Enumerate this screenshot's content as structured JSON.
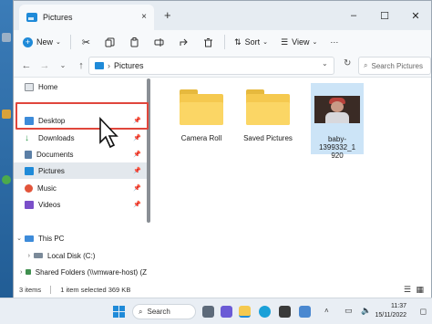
{
  "window": {
    "tab_title": "Pictures",
    "tab_close": "×",
    "new_tab": "+",
    "minimize": "–",
    "maximize": "☐",
    "close": "✕"
  },
  "toolbar": {
    "new_label": "New",
    "sort_label": "Sort",
    "view_label": "View",
    "more": "···"
  },
  "address": {
    "path": "Pictures",
    "search_placeholder": "Search Pictures"
  },
  "sidebar": {
    "items": [
      {
        "label": "Home",
        "icon": "home-icon"
      },
      {
        "label": "Desktop",
        "icon": "desktop-icon",
        "pinned": true
      },
      {
        "label": "Downloads",
        "icon": "download-icon",
        "pinned": true
      },
      {
        "label": "Documents",
        "icon": "documents-icon",
        "pinned": true
      },
      {
        "label": "Pictures",
        "icon": "pictures-icon",
        "pinned": true,
        "selected": true
      },
      {
        "label": "Music",
        "icon": "music-icon",
        "pinned": true
      },
      {
        "label": "Videos",
        "icon": "videos-icon",
        "pinned": true
      },
      {
        "label": "This PC",
        "icon": "pc-icon"
      },
      {
        "label": "Local Disk (C:)",
        "icon": "disk-icon"
      },
      {
        "label": "Shared Folders (\\\\vmware-host) (Z",
        "icon": "network-drive-icon"
      }
    ]
  },
  "content": {
    "items": [
      {
        "label": "Camera Roll",
        "type": "folder"
      },
      {
        "label": "Saved Pictures",
        "type": "folder"
      },
      {
        "label_line1": "baby-1399332_1",
        "label_line2": "920",
        "type": "image"
      }
    ]
  },
  "status": {
    "count": "3 items",
    "selection": "1 item selected  369 KB"
  },
  "taskbar": {
    "search_label": "Search",
    "time": "11:37",
    "date": "15/11/2022"
  },
  "colors": {
    "accent": "#1f8ad8",
    "highlight_box": "#e0463c",
    "selected_bg": "#cce4f7",
    "folder": "#f5c94f"
  }
}
